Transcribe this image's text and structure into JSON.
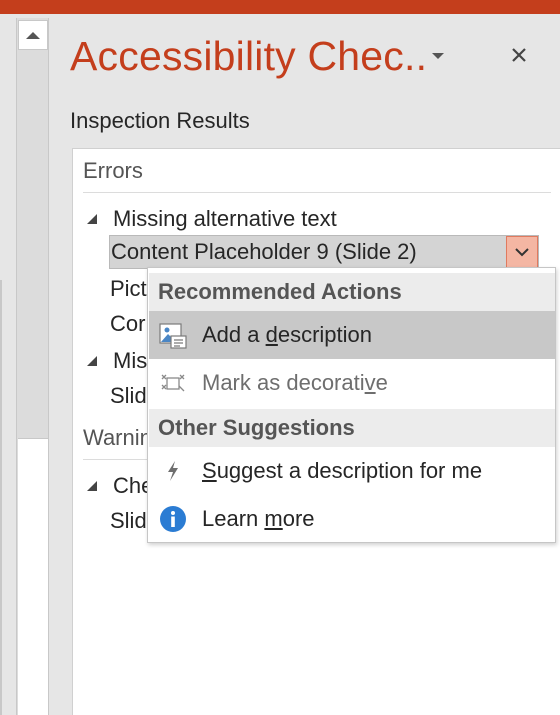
{
  "pane": {
    "title": "Accessibility Chec..",
    "section_label": "Inspection Results",
    "accent": "#c43e1c"
  },
  "results": {
    "errors_label": "Errors",
    "warnings_label": "Warnin",
    "groups": [
      {
        "label": "Missing alternative text"
      },
      {
        "label": "Mis"
      },
      {
        "label": "Che"
      }
    ],
    "items": [
      {
        "label": "Content Placeholder 9  (Slide 2)"
      },
      {
        "label": "Pict"
      },
      {
        "label": "Cor"
      },
      {
        "label": "Slid"
      },
      {
        "label": "Slid"
      }
    ]
  },
  "menu": {
    "recommended_header": "Recommended Actions",
    "other_header": "Other Suggestions",
    "items": [
      {
        "pre": "Add a ",
        "key": "d",
        "post": "escription",
        "icon": "add-description-icon"
      },
      {
        "pre": "Mark as decorati",
        "key": "v",
        "post": "e",
        "icon": "mark-decorative-icon"
      },
      {
        "pre": "",
        "key": "S",
        "post": "uggest a description for me",
        "icon": "lightning-icon"
      },
      {
        "pre": "Learn ",
        "key": "m",
        "post": "ore",
        "icon": "info-icon"
      }
    ]
  }
}
